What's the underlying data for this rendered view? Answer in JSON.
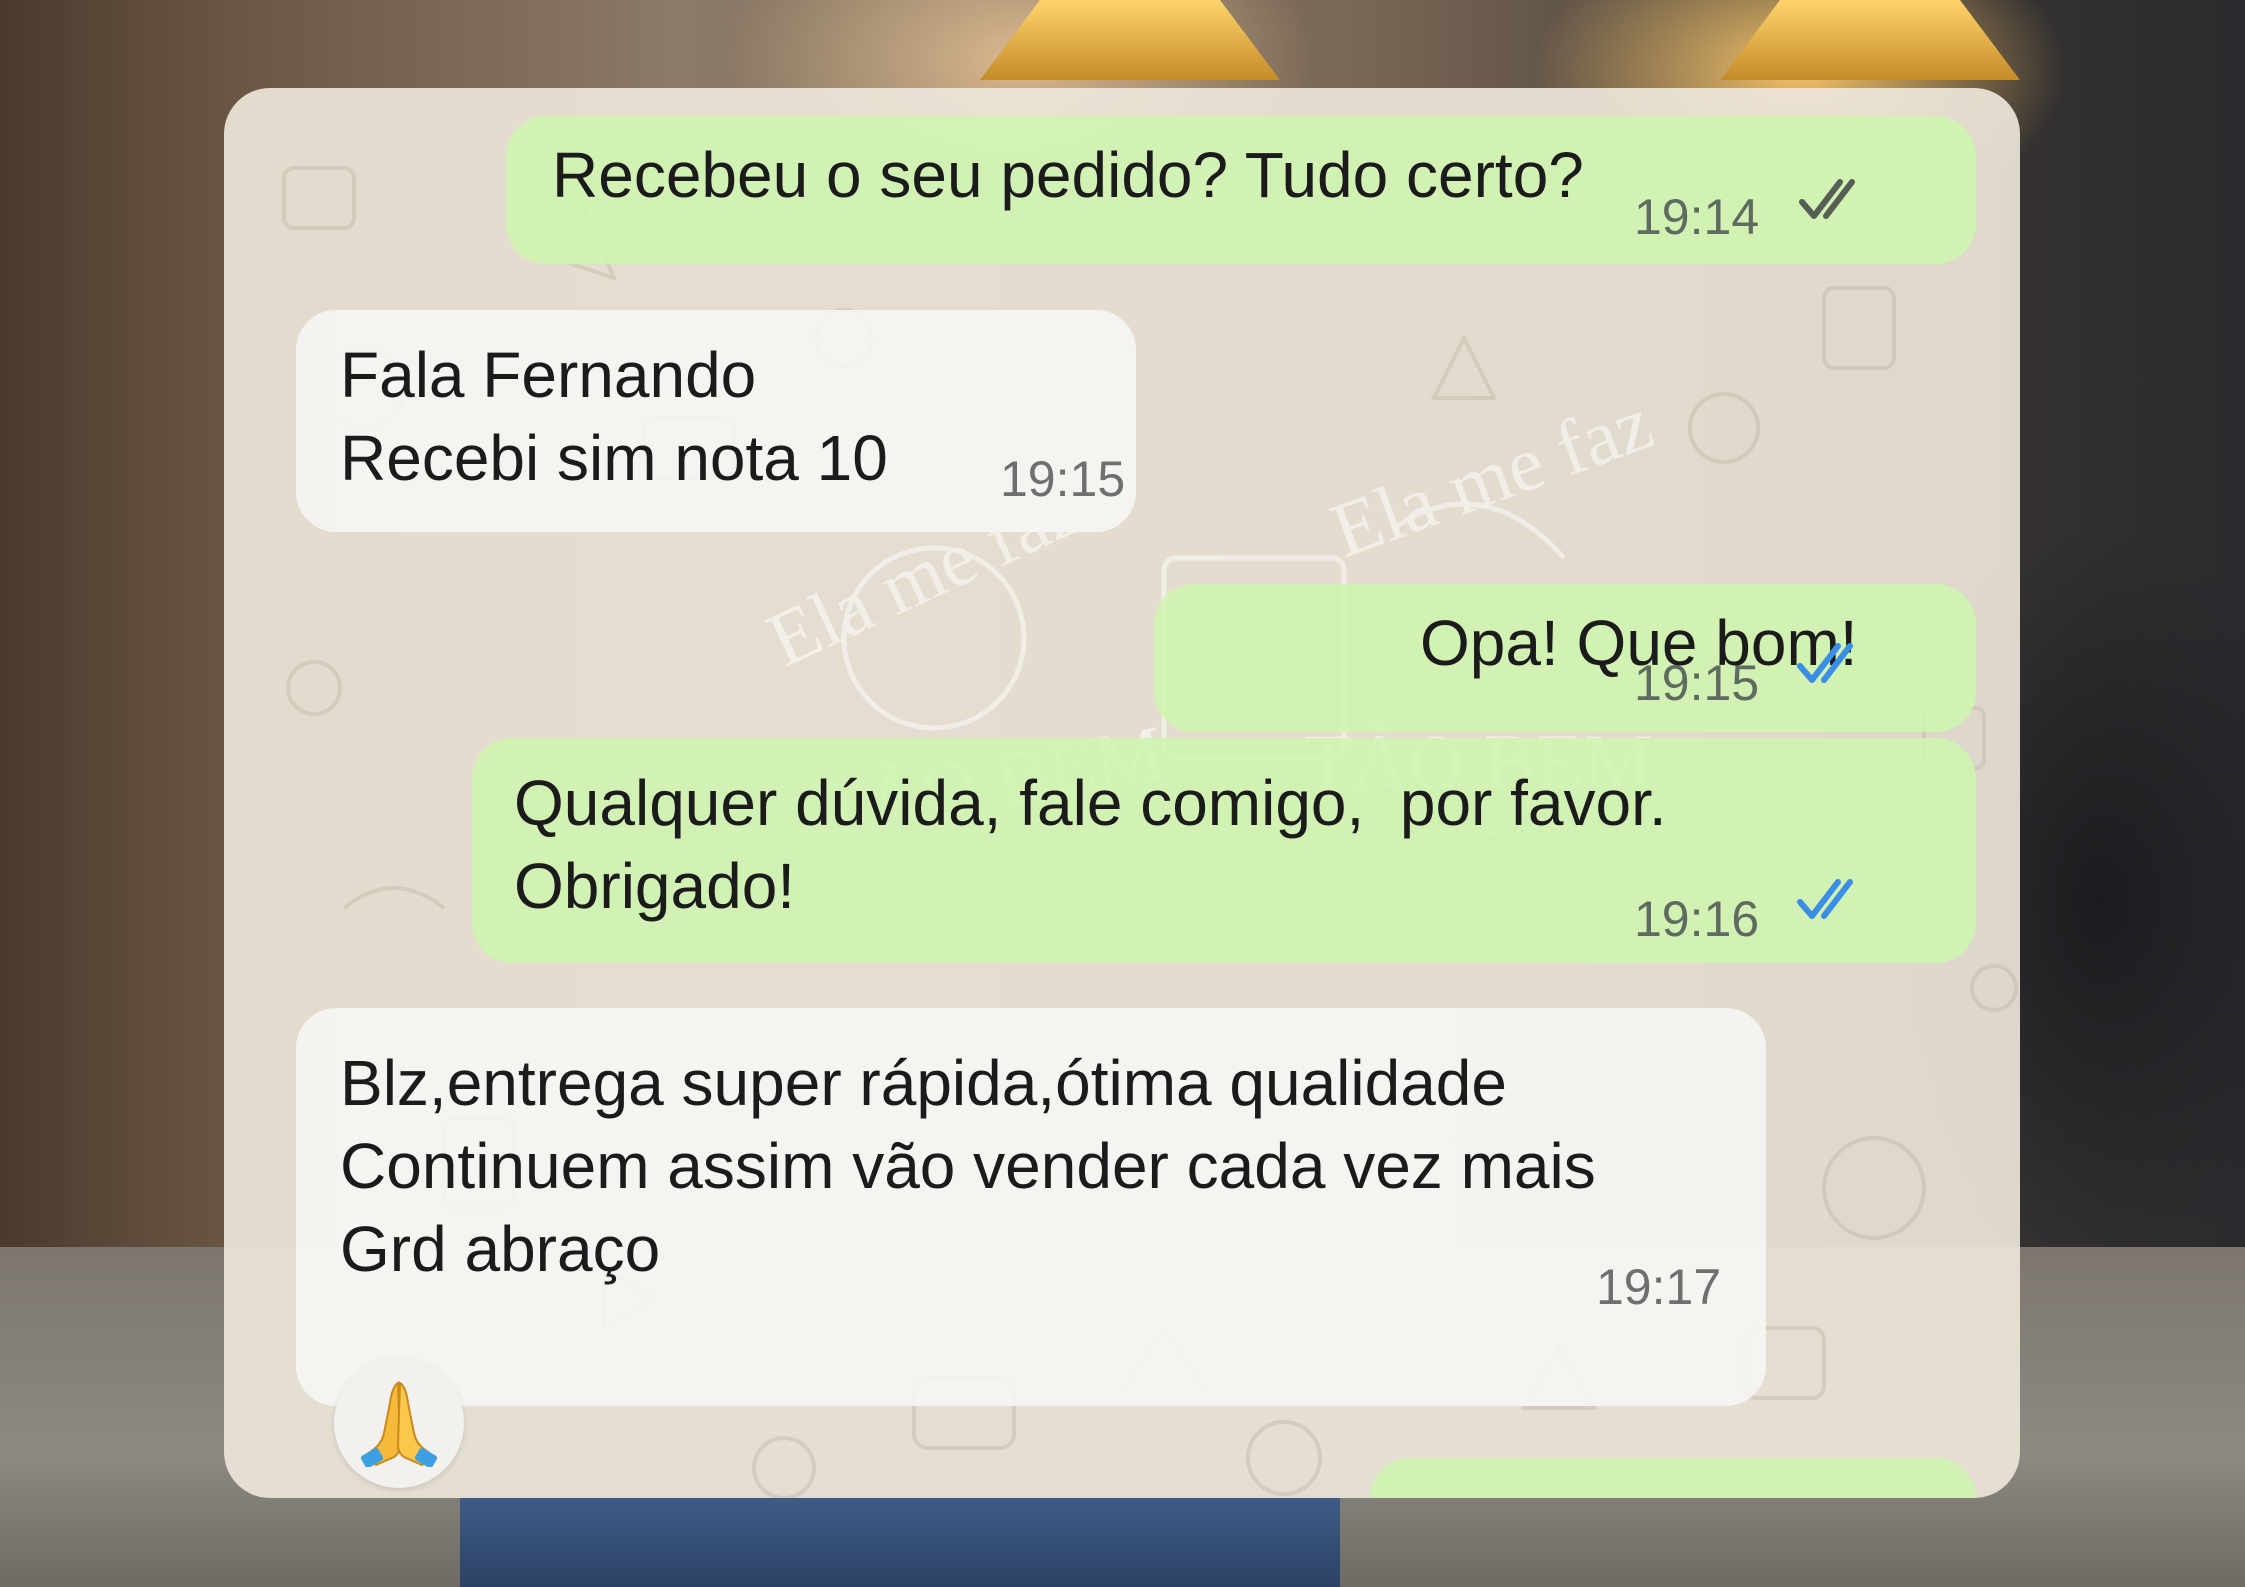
{
  "messages": [
    {
      "direction": "outgoing",
      "text": "Recebeu o seu pedido? Tudo certo?",
      "time": "19:14",
      "status": "delivered"
    },
    {
      "direction": "incoming",
      "lines": [
        "Fala Fernando",
        "Recebi sim nota 10"
      ],
      "time": "19:15"
    },
    {
      "direction": "outgoing",
      "text": "Opa! Que bom!",
      "time": "19:15",
      "status": "read"
    },
    {
      "direction": "outgoing",
      "lines": [
        "Qualquer dúvida, fale comigo,  por favor.",
        "Obrigado!"
      ],
      "time": "19:16",
      "status": "read"
    },
    {
      "direction": "incoming",
      "lines": [
        "Blz,entrega super rápida,ótima qualidade",
        "Continuem assim vão vender cada vez mais",
        "Grd abraço"
      ],
      "time": "19:17",
      "reaction": "folded-hands-emoji"
    }
  ],
  "colors": {
    "outgoing_bubble": "#cef5af",
    "incoming_bubble": "#f6f5f3",
    "read_ticks": "#3b8ee6",
    "delivered_ticks": "#555f55"
  }
}
